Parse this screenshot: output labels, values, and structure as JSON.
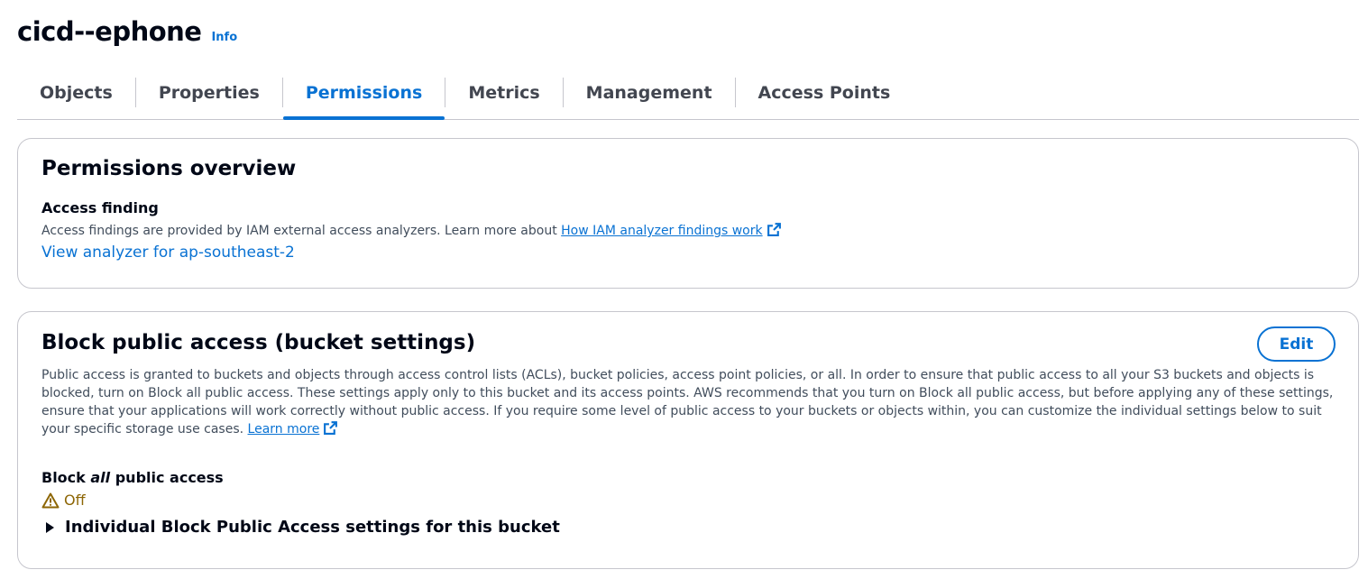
{
  "header": {
    "bucket_name": "cicd--ephone",
    "info_label": "Info"
  },
  "tabs": [
    {
      "label": "Objects"
    },
    {
      "label": "Properties"
    },
    {
      "label": "Permissions",
      "active": true
    },
    {
      "label": "Metrics"
    },
    {
      "label": "Management"
    },
    {
      "label": "Access Points"
    }
  ],
  "permissions_overview": {
    "title": "Permissions overview",
    "access_finding_label": "Access finding",
    "description": "Access findings are provided by IAM external access analyzers. Learn more about",
    "learn_link": "How IAM analyzer findings work",
    "analyzer_link": "View analyzer for ap-southeast-2"
  },
  "block_public_access": {
    "title": "Block public access (bucket settings)",
    "edit_label": "Edit",
    "description": "Public access is granted to buckets and objects through access control lists (ACLs), bucket policies, access point policies, or all. In order to ensure that public access to all your S3 buckets and objects is blocked, turn on Block all public access. These settings apply only to this bucket and its access points. AWS recommends that you turn on Block all public access, but before applying any of these settings, ensure that your applications will work correctly without public access. If you require some level of public access to your buckets or objects within, you can customize the individual settings below to suit your specific storage use cases.",
    "learn_more": "Learn more",
    "block_all_prefix": "Block",
    "block_all_emphasis": "all",
    "block_all_suffix": "public access",
    "status": "Off",
    "status_icon": "warning-icon",
    "expander_label": "Individual Block Public Access settings for this bucket"
  },
  "colors": {
    "link": "#0972d3",
    "warning": "#8d6605",
    "text": "#000716",
    "muted": "#414d5c",
    "border": "#c6c6cd"
  }
}
